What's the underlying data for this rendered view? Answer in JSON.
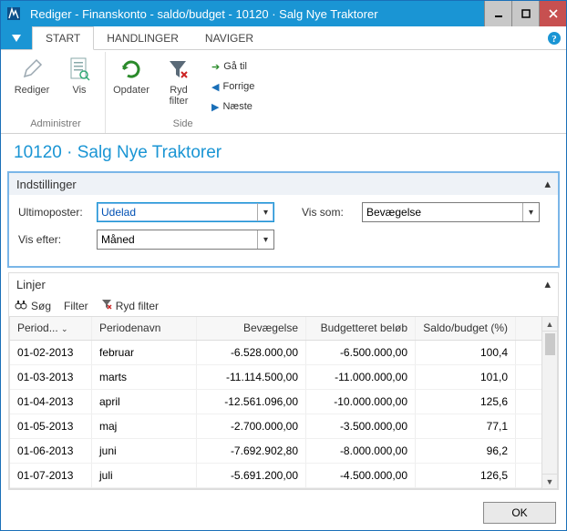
{
  "window": {
    "title": "Rediger - Finanskonto - saldo/budget - 10120 · Salg Nye Traktorer"
  },
  "tabs": {
    "start": "START",
    "handlinger": "HANDLINGER",
    "naviger": "NAVIGER"
  },
  "ribbon": {
    "rediger": "Rediger",
    "vis": "Vis",
    "opdater": "Opdater",
    "ryd_filter": "Ryd\nfilter",
    "ga_til": "Gå til",
    "forrige": "Forrige",
    "naeste": "Næste",
    "group_administrer": "Administrer",
    "group_side": "Side"
  },
  "page_title": "10120 · Salg Nye Traktorer",
  "panels": {
    "indstillinger": "Indstillinger",
    "linjer": "Linjer"
  },
  "settings": {
    "ultimoposter_label": "Ultimoposter:",
    "ultimoposter_value": "Udelad",
    "vis_som_label": "Vis som:",
    "vis_som_value": "Bevægelse",
    "vis_efter_label": "Vis efter:",
    "vis_efter_value": "Måned"
  },
  "lines_toolbar": {
    "sog": "Søg",
    "filter": "Filter",
    "ryd_filter": "Ryd filter"
  },
  "grid": {
    "headers": {
      "period": "Period...",
      "periodenavn": "Periodenavn",
      "bevaegelse": "Bevægelse",
      "budgetteret": "Budgetteret beløb",
      "saldo_budget": "Saldo/budget (%)"
    },
    "rows": [
      {
        "period": "01-02-2013",
        "name": "februar",
        "bev": "-6.528.000,00",
        "bud": "-6.500.000,00",
        "pct": "100,4"
      },
      {
        "period": "01-03-2013",
        "name": "marts",
        "bev": "-11.114.500,00",
        "bud": "-11.000.000,00",
        "pct": "101,0"
      },
      {
        "period": "01-04-2013",
        "name": "april",
        "bev": "-12.561.096,00",
        "bud": "-10.000.000,00",
        "pct": "125,6"
      },
      {
        "period": "01-05-2013",
        "name": "maj",
        "bev": "-2.700.000,00",
        "bud": "-3.500.000,00",
        "pct": "77,1"
      },
      {
        "period": "01-06-2013",
        "name": "juni",
        "bev": "-7.692.902,80",
        "bud": "-8.000.000,00",
        "pct": "96,2"
      },
      {
        "period": "01-07-2013",
        "name": "juli",
        "bev": "-5.691.200,00",
        "bud": "-4.500.000,00",
        "pct": "126,5"
      }
    ]
  },
  "footer": {
    "ok": "OK"
  },
  "glyphs": {
    "sort": "⌄"
  }
}
